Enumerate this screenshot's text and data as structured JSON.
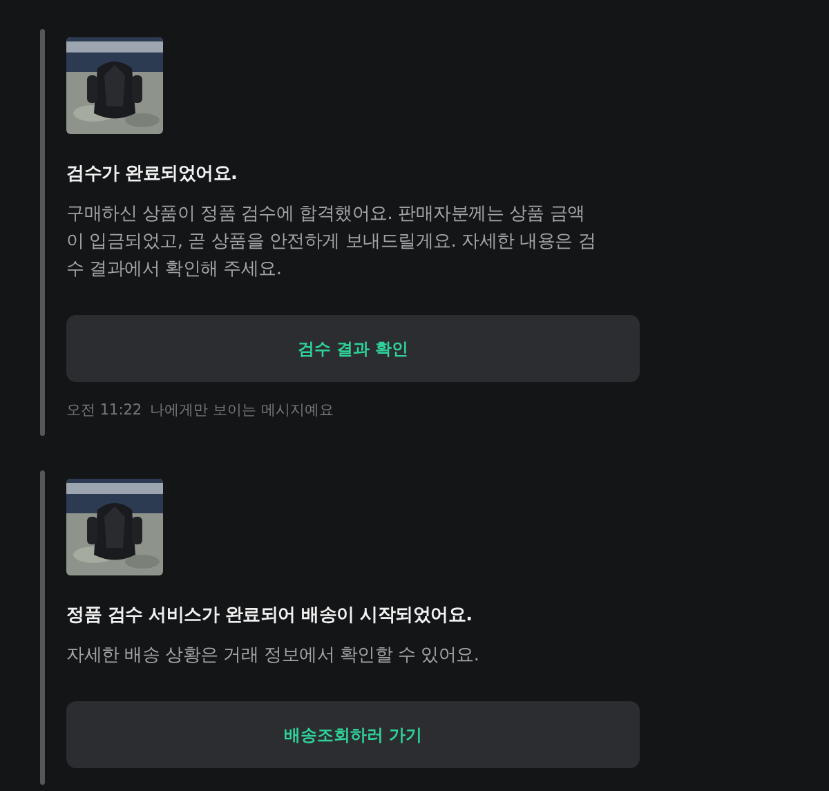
{
  "messages": [
    {
      "title": "검수가 완료되었어요.",
      "body": "구매하신 상품이 정품 검수에 합격했어요. 판매자분께는 상품 금액이 입금되었고, 곧 상품을 안전하게 보내드릴게요. 자세한 내용은 검수 결과에서 확인해 주세요.",
      "button": "검수 결과 확인",
      "time": "오전 11:22",
      "note": "나에게만 보이는 메시지예요"
    },
    {
      "title": "정품 검수 서비스가 완료되어 배송이 시작되었어요.",
      "body": "자세한 배송 상황은 거래 정보에서 확인할 수 있어요.",
      "button": "배송조회하러 가기"
    }
  ]
}
